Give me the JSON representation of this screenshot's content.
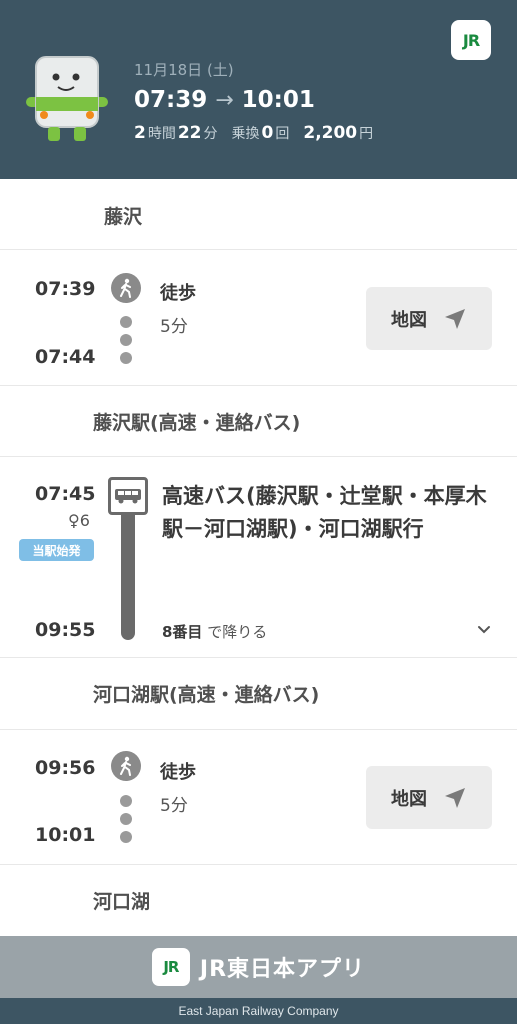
{
  "header": {
    "date": "11月18日 (土)",
    "depart": "07:39",
    "arrive": "10:01",
    "duration_hours": "2",
    "hours_unit": "時間",
    "duration_minutes": "22",
    "minutes_unit": "分",
    "transfers_label": "乗換",
    "transfers": "0",
    "transfers_unit": "回",
    "fare": "2,200",
    "fare_unit": "円",
    "logo": "JR",
    "logo_color": "#1a8a3f",
    "background": "#3d5563"
  },
  "route": {
    "start_station": "藤沢",
    "walk1": {
      "depart": "07:39",
      "arrive": "07:44",
      "mode": "徒歩",
      "duration": "5分",
      "map_label": "地図",
      "icon": "walking-person-icon"
    },
    "bus_station": "藤沢駅(高速・連絡バス)",
    "bus": {
      "depart": "07:45",
      "platform": "6",
      "origin_badge": "当駅始発",
      "title": "高速バス(藤沢駅・辻堂駅・本厚木駅－河口湖駅)・河口湖駅行",
      "arrive": "09:55",
      "stops_count": "8番目",
      "stops_suffix": "で降りる",
      "icon": "bus-icon",
      "badge_color": "#7fbee6"
    },
    "bus_end_station": "河口湖駅(高速・連絡バス)",
    "walk2": {
      "depart": "09:56",
      "arrive": "10:01",
      "mode": "徒歩",
      "duration": "5分",
      "map_label": "地図",
      "icon": "walking-person-icon"
    },
    "end_station": "河口湖"
  },
  "footer": {
    "logo": "JR",
    "app_name": "JR東日本アプリ",
    "company": "East Japan Railway Company"
  }
}
